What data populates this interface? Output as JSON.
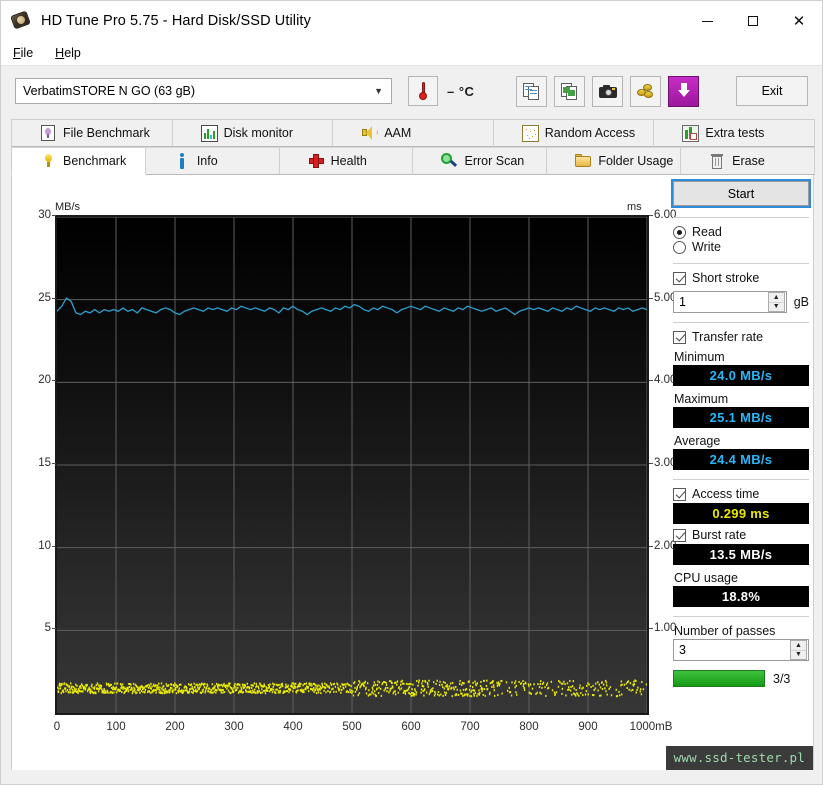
{
  "window": {
    "title": "HD Tune Pro 5.75 - Hard Disk/SSD Utility",
    "icon": "hard-disk-icon",
    "minimize": "—",
    "maximize": "□",
    "close": "✕"
  },
  "menu": {
    "items": [
      "File",
      "Help"
    ]
  },
  "toolbar": {
    "drive": "VerbatimSTORE N GO (63 gB)",
    "drive_chevron": "▼",
    "temperature": "– °C",
    "buttons": [
      {
        "name": "copy-to-clipboard-icon",
        "label": ""
      },
      {
        "name": "copy-image-icon",
        "label": ""
      },
      {
        "name": "screenshot-camera-icon",
        "label": ""
      },
      {
        "name": "gold-coins-icon",
        "label": ""
      },
      {
        "name": "download-arrow-icon",
        "label": ""
      }
    ],
    "exit_label": "Exit"
  },
  "tabs": {
    "top_row": [
      {
        "label": "File Benchmark",
        "icon": "file-benchmark-icon",
        "active": false
      },
      {
        "label": "Disk monitor",
        "icon": "disk-monitor-icon",
        "active": false
      },
      {
        "label": "AAM",
        "icon": "aam-speaker-icon",
        "active": false
      },
      {
        "label": "Random Access",
        "icon": "random-access-icon",
        "active": false
      },
      {
        "label": "Extra tests",
        "icon": "extra-tests-icon",
        "active": false
      }
    ],
    "bottom_row": [
      {
        "label": "Benchmark",
        "icon": "benchmark-bulb-icon",
        "active": true
      },
      {
        "label": "Info",
        "icon": "info-icon",
        "active": false
      },
      {
        "label": "Health",
        "icon": "health-cross-icon",
        "active": false
      },
      {
        "label": "Error Scan",
        "icon": "error-scan-magnifier-icon",
        "active": false
      },
      {
        "label": "Folder Usage",
        "icon": "folder-usage-icon",
        "active": false
      },
      {
        "label": "Erase",
        "icon": "erase-trash-icon",
        "active": false
      }
    ]
  },
  "panel": {
    "start_label": "Start",
    "mode": {
      "read_label": "Read",
      "write_label": "Write",
      "selected": "Read"
    },
    "short_stroke": {
      "label": "Short stroke",
      "checked": true,
      "value": "1",
      "unit": "gB"
    },
    "transfer_rate": {
      "label": "Transfer rate",
      "checked": true,
      "minimum_label": "Minimum",
      "minimum_value": "24.0 MB/s",
      "maximum_label": "Maximum",
      "maximum_value": "25.1 MB/s",
      "average_label": "Average",
      "average_value": "24.4 MB/s"
    },
    "access_time": {
      "label": "Access time",
      "checked": true,
      "value": "0.299 ms"
    },
    "burst_rate": {
      "label": "Burst rate",
      "checked": true,
      "value": "13.5 MB/s"
    },
    "cpu_usage": {
      "label": "CPU usage",
      "value": "18.8%"
    },
    "passes": {
      "label": "Number of passes",
      "value": "3",
      "progress_text": "3/3",
      "progress_percent": 100
    }
  },
  "watermark": "www.ssd-tester.pl",
  "chart_data": {
    "type": "line",
    "title": "",
    "ylabel_left": "MB/s",
    "ylabel_right": "ms",
    "xlabel": "mB",
    "xlim": [
      0,
      1000
    ],
    "xticks": [
      0,
      100,
      200,
      300,
      400,
      500,
      600,
      700,
      800,
      900,
      1000
    ],
    "xtick_labels": [
      "0",
      "100",
      "200",
      "300",
      "400",
      "500",
      "600",
      "700",
      "800",
      "900",
      "1000mB"
    ],
    "left_axis": {
      "label": "MB/s",
      "ylim": [
        0,
        30
      ],
      "ticks": [
        5,
        10,
        15,
        20,
        25,
        30
      ],
      "tick_labels": [
        "5",
        "10",
        "15",
        "20",
        "25",
        "30"
      ]
    },
    "right_axis": {
      "label": "ms",
      "ylim": [
        0,
        6
      ],
      "ticks": [
        1.0,
        2.0,
        3.0,
        4.0,
        5.0,
        6.0
      ],
      "tick_labels": [
        "1.00",
        "2.00",
        "3.00",
        "4.00",
        "5.00",
        "6.00"
      ]
    },
    "grid": true,
    "legend": "none",
    "background": "#101010",
    "series": [
      {
        "name": "Transfer rate",
        "axis": "left",
        "color": "#2f9fd0",
        "units": "MB/s",
        "x": [
          0,
          8,
          16,
          24,
          32,
          40,
          48,
          56,
          64,
          72,
          80,
          88,
          96,
          104,
          112,
          120,
          128,
          136,
          144,
          152,
          160,
          168,
          176,
          184,
          192,
          200,
          208,
          216,
          224,
          232,
          240,
          248,
          256,
          264,
          272,
          280,
          288,
          296,
          304,
          312,
          320,
          328,
          336,
          344,
          352,
          360,
          368,
          376,
          384,
          392,
          400,
          408,
          416,
          424,
          432,
          440,
          448,
          456,
          464,
          472,
          480,
          488,
          496,
          504,
          512,
          520,
          528,
          536,
          544,
          552,
          560,
          568,
          576,
          584,
          592,
          600,
          608,
          616,
          624,
          632,
          640,
          648,
          656,
          664,
          672,
          680,
          688,
          696,
          704,
          712,
          720,
          728,
          736,
          744,
          752,
          760,
          768,
          776,
          784,
          792,
          800,
          808,
          816,
          824,
          832,
          840,
          848,
          856,
          864,
          872,
          880,
          888,
          896,
          904,
          912,
          920,
          928,
          936,
          944,
          952,
          960,
          968,
          976,
          984,
          992,
          1000
        ],
        "y": [
          24.3,
          24.6,
          25.1,
          24.9,
          24.2,
          24.1,
          24.3,
          24.2,
          24.4,
          24.2,
          24.4,
          24.3,
          24.4,
          24.3,
          24.5,
          24.3,
          24.4,
          24.2,
          24.5,
          24.4,
          24.3,
          24.2,
          24.4,
          24.5,
          24.4,
          24.2,
          24.1,
          24.3,
          24.4,
          24.5,
          24.4,
          24.3,
          24.5,
          24.4,
          24.5,
          24.4,
          24.3,
          24.5,
          24.4,
          24.6,
          24.5,
          24.4,
          24.5,
          24.4,
          24.3,
          24.5,
          24.4,
          24.2,
          24.5,
          24.4,
          24.6,
          24.4,
          24.3,
          24.1,
          24.3,
          24.4,
          24.5,
          24.4,
          24.3,
          24.5,
          24.4,
          24.6,
          24.5,
          24.7,
          24.6,
          24.4,
          24.3,
          24.5,
          24.4,
          24.6,
          24.5,
          24.4,
          24.2,
          24.4,
          24.5,
          24.6,
          24.5,
          24.4,
          24.6,
          24.5,
          24.4,
          24.3,
          24.5,
          24.4,
          24.3,
          24.5,
          24.4,
          24.6,
          24.5,
          24.4,
          24.3,
          24.4,
          24.5,
          24.3,
          24.4,
          24.5,
          24.3,
          24.1,
          24.3,
          24.4,
          24.5,
          24.4,
          24.5,
          24.4,
          24.3,
          24.5,
          24.4,
          24.3,
          24.5,
          24.4,
          24.6,
          24.5,
          24.4,
          24.3,
          24.5,
          24.4,
          24.5,
          24.4,
          24.3,
          24.5,
          24.4,
          24.5,
          24.3,
          24.4,
          24.5,
          24.4
        ]
      },
      {
        "name": "Access time",
        "axis": "right",
        "color": "#ecec00",
        "units": "ms",
        "style": "scatter",
        "mean": 0.299,
        "spread": 0.06,
        "note": "dense yellow dot band near 0.3 ms across full range"
      }
    ]
  }
}
